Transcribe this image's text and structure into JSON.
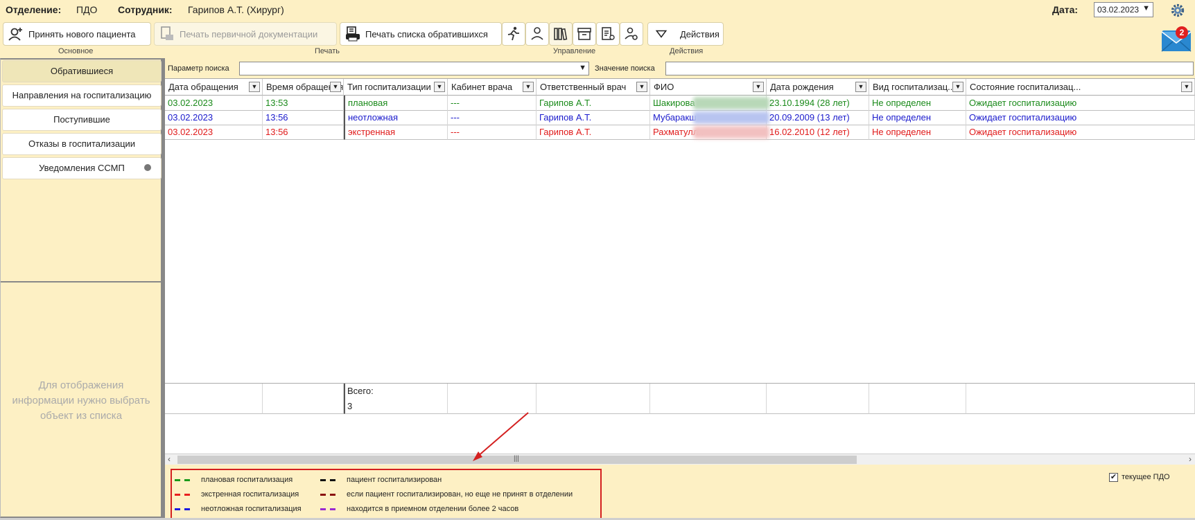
{
  "topbar": {
    "department_label": "Отделение:",
    "department_value": "ПДО",
    "employee_label": "Сотрудник:",
    "employee_value": "Гарипов А.Т. (Хирург)",
    "date_label": "Дата:",
    "date_value": "03.02.2023"
  },
  "toolbar": {
    "accept_patient": "Принять нового пациента",
    "print_primary_docs": "Печать первичной документации",
    "print_list": "Печать списка обратившихся",
    "actions": "Действия",
    "group_main": "Основное",
    "group_print": "Печать",
    "group_manage": "Управление",
    "group_actions": "Действия"
  },
  "mail": {
    "badge": "2"
  },
  "sidebar": {
    "items": [
      {
        "label": "Обратившиеся"
      },
      {
        "label": "Направления на госпитализацию"
      },
      {
        "label": "Поступившие"
      },
      {
        "label": "Отказы в госпитализации"
      },
      {
        "label": "Уведомления ССМП"
      }
    ],
    "empty_message_line1": "Для отображения",
    "empty_message_line2": "информации нужно выбрать",
    "empty_message_line3": "объект из списка"
  },
  "search": {
    "param_label": "Параметр поиска",
    "value_label": "Значение поиска"
  },
  "table": {
    "columns": [
      "Дата обращения",
      "Время обращения",
      "Тип госпитализации",
      "Кабинет врача",
      "Ответственный врач",
      "ФИО",
      "Дата рождения",
      "Вид  госпитализац...",
      "Состояние  госпитализац..."
    ],
    "rows": [
      {
        "color": "#1a8a1a",
        "cells": [
          "03.02.2023",
          "13:53",
          "плановая",
          "---",
          "Гарипов А.Т.",
          "Шакирова",
          "23.10.1994 (28 лет)",
          "Не определен",
          "Ожидает госпитализацию"
        ]
      },
      {
        "color": "#1a1acc",
        "cells": [
          "03.02.2023",
          "13:56",
          "неотложная",
          "---",
          "Гарипов А.Т.",
          "Мубаракш",
          "20.09.2009 (13 лет)",
          "Не определен",
          "Ожидает госпитализацию"
        ]
      },
      {
        "color": "#e01a1a",
        "cells": [
          "03.02.2023",
          "13:56",
          "экстренная",
          "---",
          "Гарипов А.Т.",
          "Рахматулли",
          "16.02.2010 (12 лет)",
          "Не определен",
          "Ожидает госпитализацию"
        ]
      }
    ],
    "total_label": "Всего:",
    "total_value": "3"
  },
  "legend": {
    "items": [
      {
        "label": "плановая госпитализация",
        "color": "#1a9a1a"
      },
      {
        "label": "экстренная госпитализация",
        "color": "#e82020"
      },
      {
        "label": "неотложная госпитализация",
        "color": "#1a1ae0"
      },
      {
        "label": "пациент госпитализирован",
        "color": "#111111"
      },
      {
        "label": "если пациент госпитализирован, но еще не принят в  отделении",
        "color": "#8a1010"
      },
      {
        "label": "находится в приемном отделении более 2 часов",
        "color": "#9a2ad0"
      }
    ]
  },
  "current_pdo": {
    "label": "текущее ПДО",
    "checked": true
  }
}
